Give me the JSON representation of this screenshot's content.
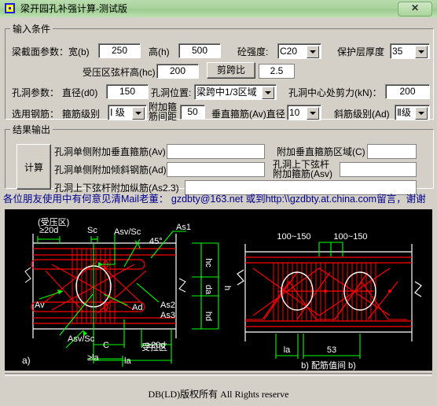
{
  "window": {
    "title": "梁开园孔补强计算-测试版",
    "close_label": "✕",
    "app_icon": "app-window-icon"
  },
  "input_group": {
    "legend": "输入条件",
    "beam_section_label": "梁截面参数：",
    "width_label": "宽(b)",
    "width_value": "250",
    "height_label": "高(h)",
    "height_value": "500",
    "concrete_label": "砼强度:",
    "concrete_value": "C20",
    "cover_label": "保护层厚度",
    "cover_value": "35",
    "hc_label": "受压区弦杆高(hc)",
    "hc_value": "200",
    "shear_span_button": "剪跨比",
    "shear_span_value": "2.5",
    "hole_param_label": "孔洞参数：",
    "diameter_label": "直径(d0)",
    "diameter_value": "150",
    "hole_pos_label": "孔洞位置:",
    "hole_pos_value": "梁跨中1/3区域",
    "shear_at_hole_label": "孔洞中心处剪力(kN)：",
    "shear_at_hole_value": "200",
    "rebar_select_label": "选用钢筋：",
    "stirrup_grade_label": "箍筋级别",
    "stirrup_grade_value": "Ⅰ 级",
    "add_stirrup_spacing_label_line1": "附加箍",
    "add_stirrup_spacing_label_line2": "筋间距",
    "add_stirrup_spacing_value": "50",
    "av_diameter_label": "垂直箍筋(Av)直径",
    "av_diameter_value": "10",
    "diagonal_grade_label": "斜筋级别(Ad)",
    "diagonal_grade_value": "Ⅱ级"
  },
  "result_group": {
    "legend": "结果输出",
    "calc_button": "计算",
    "av_label": "孔洞单侧附加垂直箍筋(Av)",
    "av_value": "",
    "ad_label": "孔洞单侧附加倾斜钢筋(Ad)",
    "ad_value": "",
    "as23_label": "孔洞上下弦杆附加纵筋(As2.3)",
    "as23_value": "",
    "c_label": "附加垂直箍筋区域(C)",
    "c_value": "",
    "asv_label_line1": "孔洞上下弦杆",
    "asv_label_line2": "附加箍筋(Asv)",
    "asv_value": ""
  },
  "notice": "各位朋友使用中有何意见清Mail老董： gzdbty@163.net 或到http:\\\\gzdbty.at.china.com留言，谢谢",
  "copyright": "DB(LD)版权所有 All Rights reserve",
  "colors": {
    "titlebar": "#a9d39c",
    "face": "#d4d0c8",
    "notice_text": "#00008b",
    "drawing_bg": "#000000",
    "rebar_red": "#ff0000",
    "dim_green": "#00ff00",
    "outline_white": "#ffffff"
  },
  "drawing": {
    "left_figure": {
      "caption": "a)",
      "zone_top": "(受压区)",
      "zone_bottom": "受拉区",
      "labels": [
        "≥20d",
        "Sc",
        "Asv/Sc",
        "45°",
        "As1",
        "Av",
        "Ad",
        "As2",
        "As3",
        "Asv/Sc",
        "C",
        "≥20d",
        "la",
        "≥la",
        "hc",
        "da",
        "hd",
        "h"
      ]
    },
    "right_figure": {
      "caption": "b) 配筋值间  b)",
      "labels": [
        "100~150",
        "100~150",
        "la",
        "53"
      ]
    }
  }
}
